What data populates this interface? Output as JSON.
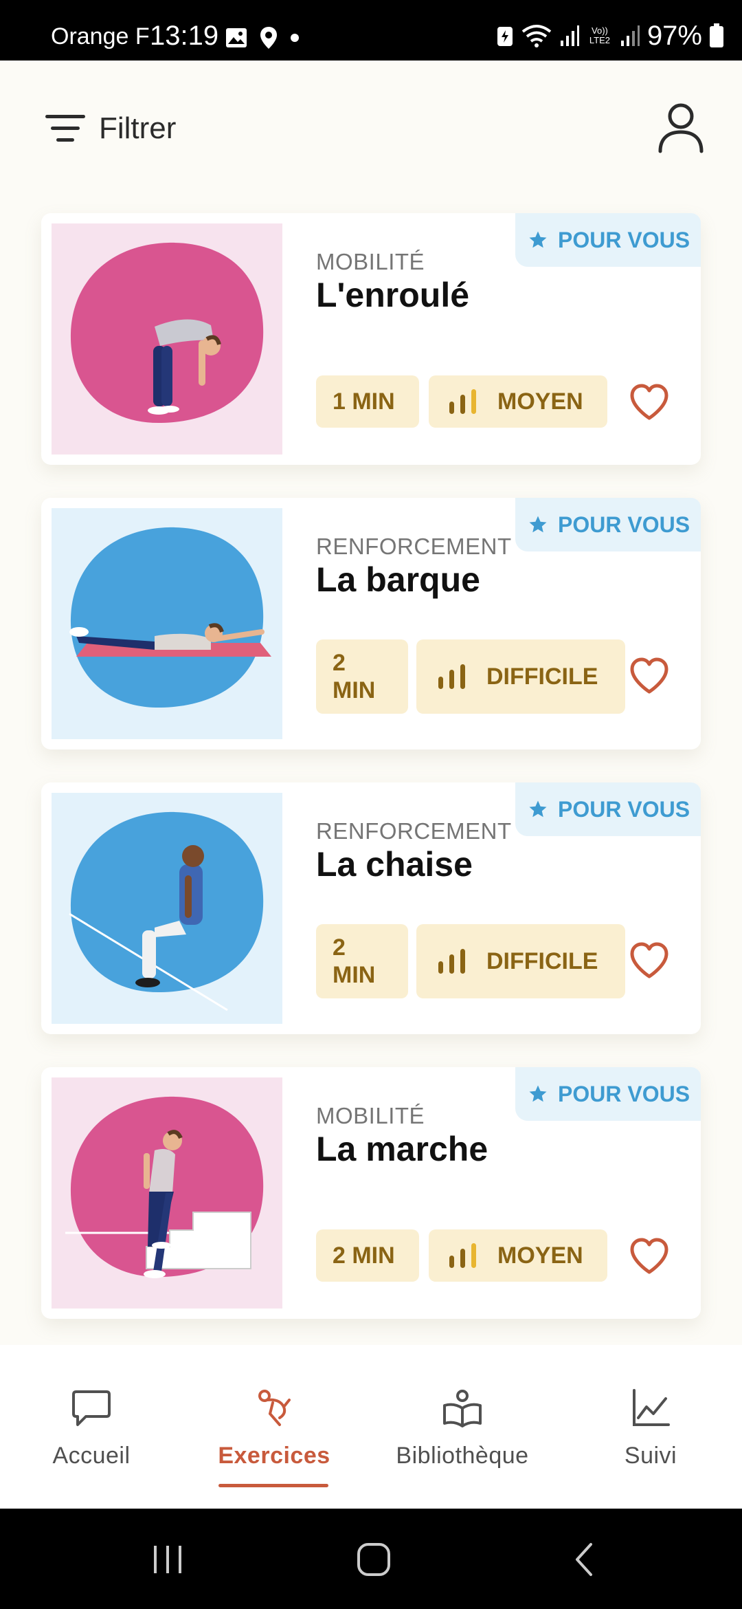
{
  "status_bar": {
    "carrier": "Orange F",
    "time": "13:19",
    "battery_percent": "97%",
    "network": "Vo)) LTE2"
  },
  "header": {
    "filter_label": "Filtrer",
    "profile_icon": "user-icon",
    "filter_icon": "filter-lines-icon"
  },
  "cards": [
    {
      "badge": "POUR VOUS",
      "category": "MOBILITÉ",
      "title": "L'enroulé",
      "duration": "1 MIN",
      "level": "MOYEN",
      "level_bars": 2,
      "theme": "pink"
    },
    {
      "badge": "POUR VOUS",
      "category": "RENFORCEMENT",
      "title": "La barque",
      "duration_line1": "2",
      "duration_line2": "MIN",
      "level": "DIFFICILE",
      "level_bars": 3,
      "theme": "blue"
    },
    {
      "badge": "POUR VOUS",
      "category": "RENFORCEMENT",
      "title": "La chaise",
      "duration_line1": "2",
      "duration_line2": "MIN",
      "level": "DIFFICILE",
      "level_bars": 3,
      "theme": "blue"
    },
    {
      "badge": "POUR VOUS",
      "category": "MOBILITÉ",
      "title": "La marche",
      "duration": "2 MIN",
      "level": "MOYEN",
      "level_bars": 2,
      "theme": "pink"
    }
  ],
  "bottom_nav": [
    {
      "label": "Accueil",
      "icon": "chat-bubble-icon",
      "active": false
    },
    {
      "label": "Exercices",
      "icon": "exercise-figure-icon",
      "active": true
    },
    {
      "label": "Bibliothèque",
      "icon": "reader-book-icon",
      "active": false
    },
    {
      "label": "Suivi",
      "icon": "line-chart-icon",
      "active": false
    }
  ],
  "colors": {
    "accent": "#c85a3c",
    "badge_text": "#3e9bd1",
    "chip_bg": "#faefd1",
    "chip_text": "#8a6414",
    "level_bar": "#e8b530",
    "pink_blob": "#d95590",
    "blue_blob": "#48a2dc"
  }
}
